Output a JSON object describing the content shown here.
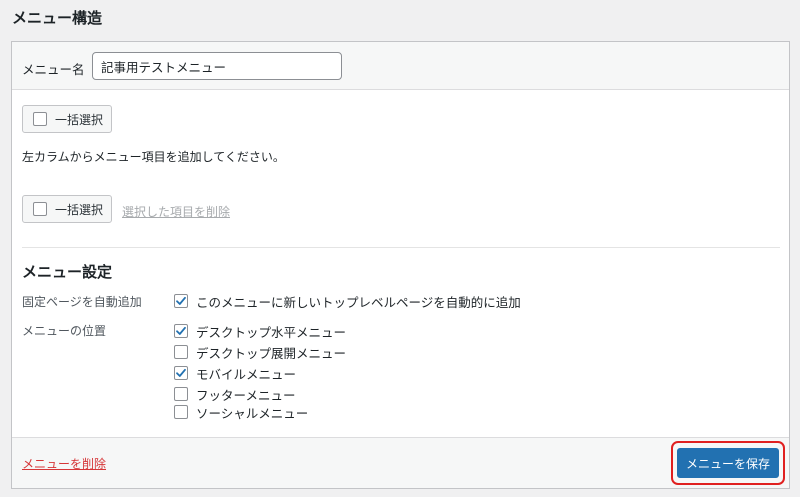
{
  "page_title": "メニュー構造",
  "menu_name": {
    "label": "メニュー名",
    "value": "記事用テストメニュー"
  },
  "bulk_select_label": "一括選択",
  "instruction": "左カラムからメニュー項目を追加してください。",
  "remove_selected_label": "選択した項目を削除",
  "settings": {
    "title": "メニュー設定",
    "auto_add": {
      "label": "固定ページを自動追加",
      "option": {
        "label": "このメニューに新しいトップレベルページを自動的に追加",
        "checked": true
      }
    },
    "location": {
      "label": "メニューの位置",
      "options": [
        {
          "label": "デスクトップ水平メニュー",
          "checked": true
        },
        {
          "label": "デスクトップ展開メニュー",
          "checked": false
        },
        {
          "label": "モバイルメニュー",
          "checked": true
        },
        {
          "label": "フッターメニュー",
          "checked": false
        },
        {
          "label": "ソーシャルメニュー",
          "checked": false
        }
      ]
    }
  },
  "footer": {
    "delete_label": "メニューを削除",
    "save_label": "メニューを保存"
  },
  "colors": {
    "accent": "#2271b1",
    "delete": "#d63638",
    "highlight": "#e02020"
  }
}
